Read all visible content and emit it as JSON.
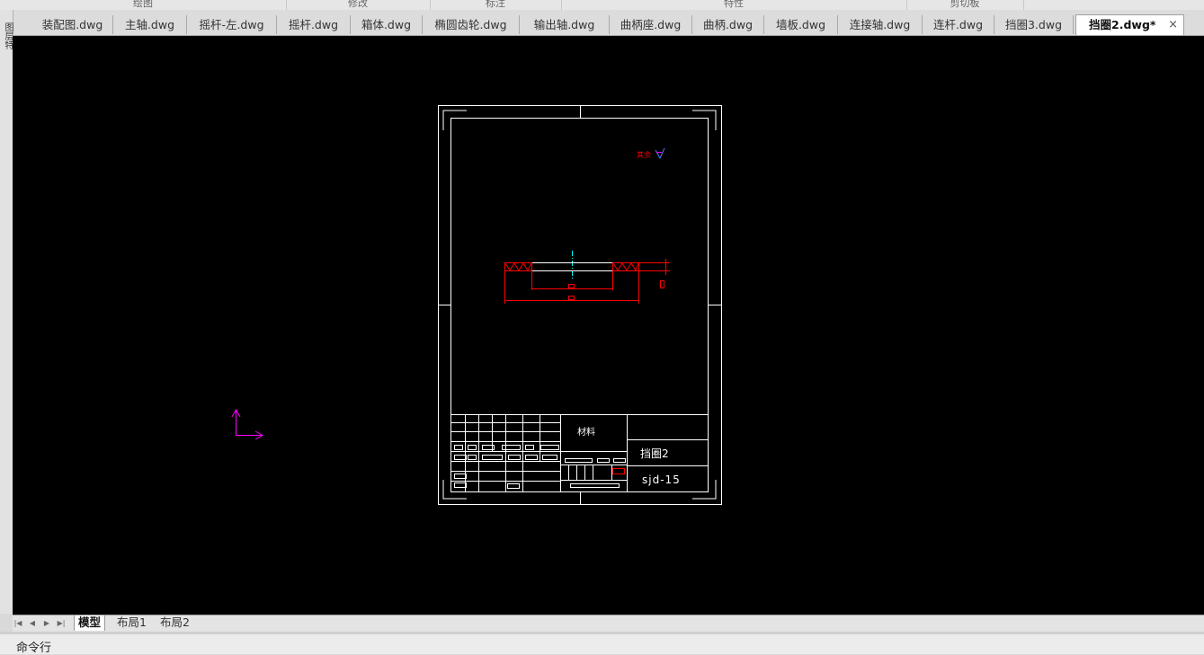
{
  "ribbon": {
    "groups": [
      "绘图",
      "修改",
      "标注",
      "特性",
      "剪切板"
    ]
  },
  "tabs": [
    {
      "label": "装配图.dwg"
    },
    {
      "label": "主轴.dwg"
    },
    {
      "label": "摇杆-左.dwg"
    },
    {
      "label": "摇杆.dwg"
    },
    {
      "label": "箱体.dwg"
    },
    {
      "label": "椭圆齿轮.dwg"
    },
    {
      "label": "输出轴.dwg"
    },
    {
      "label": "曲柄座.dwg"
    },
    {
      "label": "曲柄.dwg"
    },
    {
      "label": "墙板.dwg"
    },
    {
      "label": "连接轴.dwg"
    },
    {
      "label": "连杆.dwg"
    },
    {
      "label": "挡圈3.dwg"
    },
    {
      "label": "挡圈2.dwg*",
      "active": true
    }
  ],
  "tab_close_glyph": "×",
  "left_strip": {
    "label": "图层特"
  },
  "drawing": {
    "title_block": {
      "material_text": "材料",
      "part_name": "挡圈2",
      "drawing_number": "sjd-15"
    },
    "roughness_label": "其余"
  },
  "colors": {
    "canvas_bg": "#000000",
    "line_white": "#ffffff",
    "line_red": "#ff0000",
    "centerline_cyan": "#00ffff",
    "ucs_magenta": "#ff00ff",
    "roughness_blue": "#4f7cff"
  },
  "layout_tabs": {
    "nav_icons": [
      "first-icon",
      "prev-icon",
      "next-icon",
      "last-icon"
    ],
    "nav_glyphs": [
      "|◀",
      "◀",
      "▶",
      "▶|"
    ],
    "items": [
      {
        "label": "模型",
        "active": true
      },
      {
        "label": "布局1"
      },
      {
        "label": "布局2"
      }
    ]
  },
  "command_line": {
    "label": "命令行"
  }
}
